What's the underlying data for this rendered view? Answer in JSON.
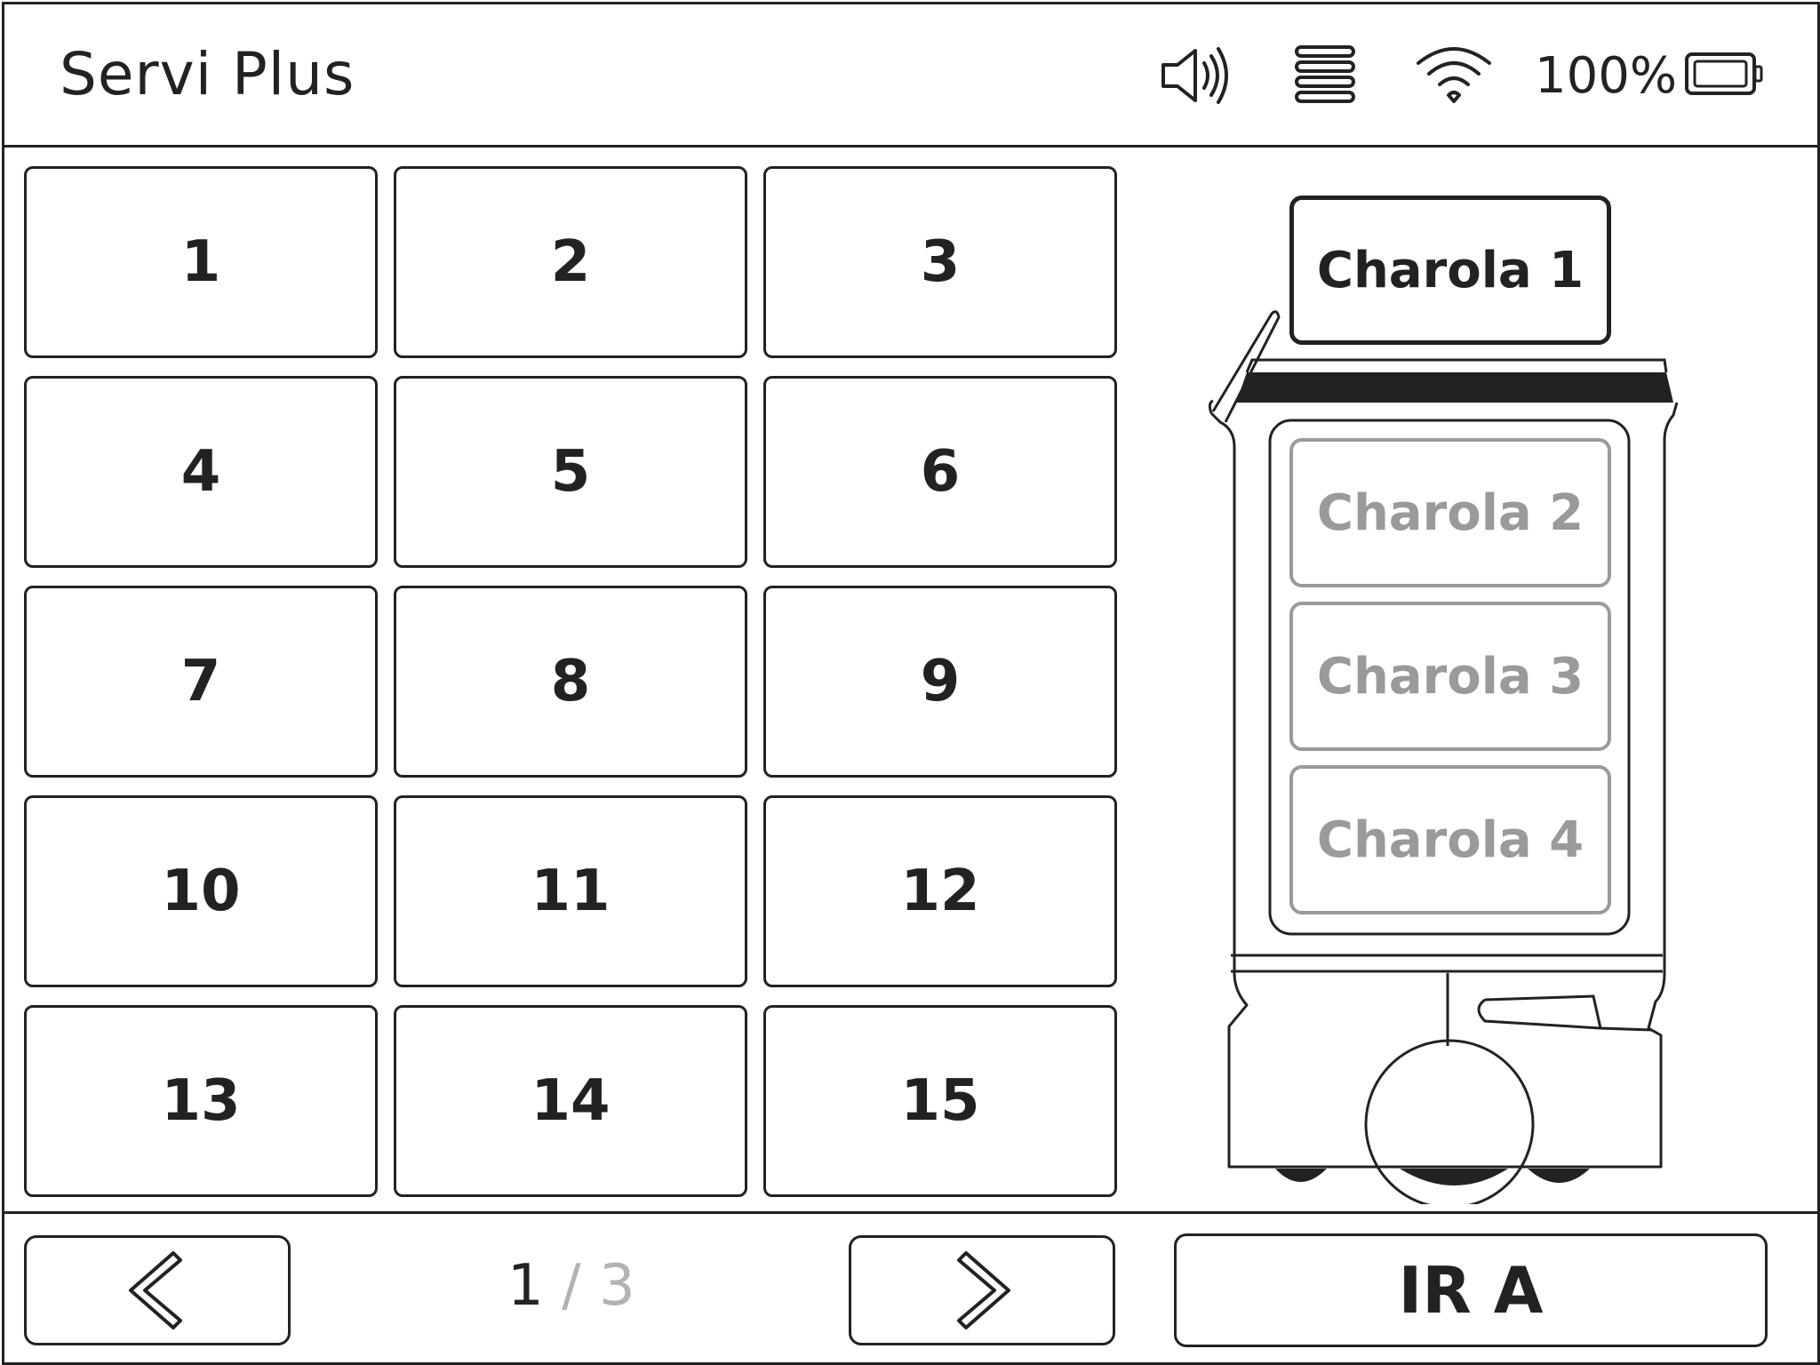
{
  "header": {
    "app_title": "Servi Plus",
    "battery_percent": "100%",
    "icons": [
      "speaker-icon",
      "menu-lines-icon",
      "wifi-icon",
      "battery-icon"
    ]
  },
  "tables": [
    "1",
    "2",
    "3",
    "4",
    "5",
    "6",
    "7",
    "8",
    "9",
    "10",
    "11",
    "12",
    "13",
    "14",
    "15"
  ],
  "trays": {
    "selected": "Charola 1",
    "others": [
      "Charola 2",
      "Charola 3",
      "Charola 4"
    ]
  },
  "footer": {
    "page_current": "1",
    "page_separator": "/",
    "page_total": "3",
    "go_label": "IR A",
    "prev_icon": "chevron-left-icon",
    "next_icon": "chevron-right-icon"
  },
  "colors": {
    "ink": "#222222",
    "inactive": "#9a9a9a",
    "page_muted": "#b3b3b3",
    "background": "#ffffff"
  }
}
